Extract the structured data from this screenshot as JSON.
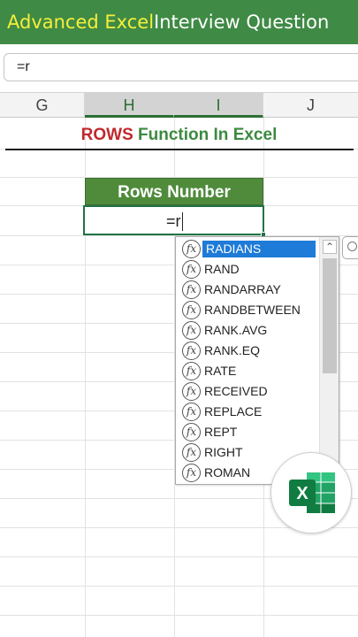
{
  "banner": {
    "highlight": "Advanced Excel",
    "rest": " Interview Question"
  },
  "formula_bar": {
    "value": "=r"
  },
  "columns": [
    {
      "label": "G",
      "selected": false
    },
    {
      "label": "H",
      "selected": true
    },
    {
      "label": "I",
      "selected": true
    },
    {
      "label": "J",
      "selected": false
    }
  ],
  "sheet_title": {
    "part1": "ROWS",
    "part2": " Function In Excel"
  },
  "table": {
    "header": "Rows Number",
    "active_value": "=r"
  },
  "autocomplete": {
    "icon": "fx-function-icon",
    "items": [
      "RADIANS",
      "RAND",
      "RANDARRAY",
      "RANDBETWEEN",
      "RANK.AVG",
      "RANK.EQ",
      "RATE",
      "RECEIVED",
      "REPLACE",
      "REPT",
      "RIGHT",
      "ROMAN"
    ],
    "selected": "RADIANS"
  },
  "logo": {
    "letter": "X",
    "brand_color": "#21a366",
    "accent_color": "#107c41"
  },
  "colors": {
    "banner": "#3f8a45",
    "highlight": "#f6ef3a",
    "title_red": "#c0282d",
    "title_green": "#3c8a40",
    "header_green": "#4f8b3b",
    "selection": "#1e7bd7"
  }
}
